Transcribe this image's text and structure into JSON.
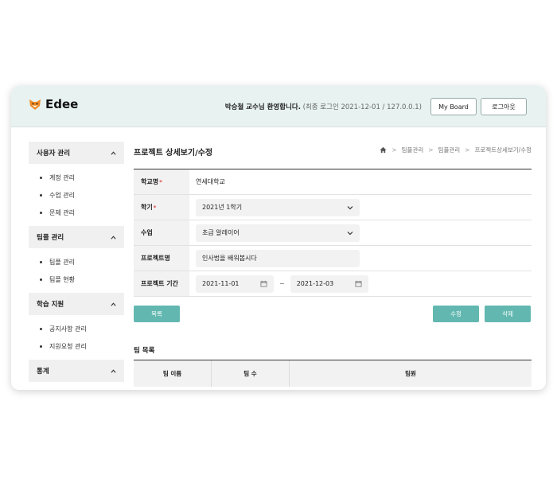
{
  "app": {
    "logo": "Edee",
    "welcome_name": "박승철 교수님 환영합니다.",
    "welcome_last": " (최종 로그인 2021-12-01 / 127.0.0.1)",
    "my_board": "My Board",
    "logout": "로그아웃"
  },
  "sidebar": {
    "sections": [
      {
        "title": "사용자 관리",
        "items": [
          "계정 관리",
          "수업 관리",
          "문제 관리"
        ]
      },
      {
        "title": "팀플 관리",
        "items": [
          "팀플 관리",
          "팀플 현황"
        ]
      },
      {
        "title": "학습 지원",
        "items": [
          "공지사항 관리",
          "지원요청 관리"
        ]
      },
      {
        "title": "통계",
        "items": []
      }
    ]
  },
  "page": {
    "title": "프로젝트 상세보기/수정",
    "breadcrumb": [
      "팀플관리",
      "팀플관리",
      "프로젝트상세보기/수정"
    ]
  },
  "form": {
    "school_label": "학교명",
    "school_value": "연세대학교",
    "term_label": "학기",
    "term_value": "2021년 1학기",
    "class_label": "수업",
    "class_value": "초급 알레이어",
    "project_label": "프로젝트명",
    "project_value": "인사법을 배워봅시다",
    "period_label": "프로젝트 기간",
    "start_date": "2021-11-01",
    "tilde": "~",
    "end_date": "2021-12-03",
    "required_mark": "*"
  },
  "buttons": {
    "list": "목록",
    "edit": "수정",
    "delete": "삭제"
  },
  "team": {
    "title": "팀 목록",
    "columns": [
      "팀 이름",
      "팀 수",
      "팀원"
    ]
  },
  "colors": {
    "accent": "#62b8b0",
    "header_bg": "#e7f2f1"
  }
}
